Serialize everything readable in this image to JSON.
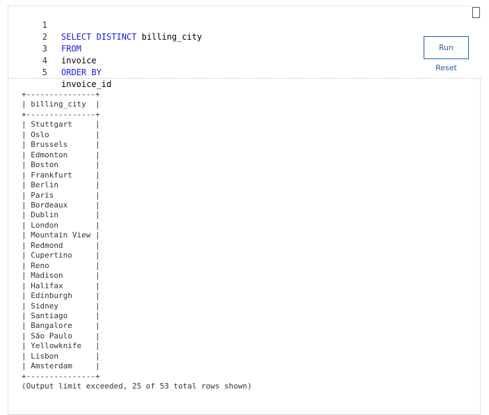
{
  "editor": {
    "lines": [
      {
        "number": "1",
        "text": "SELECT DISTINCT billing_city",
        "keyword": "SELECT DISTINCT",
        "rest": " billing_city"
      },
      {
        "number": "2",
        "text": "FROM",
        "keyword": "FROM",
        "rest": ""
      },
      {
        "number": "3",
        "text": "invoice",
        "keyword": "",
        "rest": "invoice"
      },
      {
        "number": "4",
        "text": "ORDER BY",
        "keyword": "ORDER BY",
        "rest": ""
      },
      {
        "number": "5",
        "text": "invoice_id",
        "keyword": "",
        "rest": "invoice_id"
      }
    ],
    "keyword_color": "#1b1bd6"
  },
  "actions": {
    "run_label": "Run",
    "reset_label": "Reset",
    "accent_color": "#1f5fa8"
  },
  "output": {
    "border_line": "+---------------+",
    "column_header": "billing_city",
    "rows": [
      "Stuttgart",
      "Oslo",
      "Brussels",
      "Edmonton",
      "Boston",
      "Frankfurt",
      "Berlin",
      "Paris",
      "Bordeaux",
      "Dublin",
      "London",
      "Mountain View",
      "Redmond",
      "Cupertino",
      "Reno",
      "Madison",
      "Halifax",
      "Edinburgh",
      "Sidney",
      "Santiago",
      "Bangalore",
      "São Paulo",
      "Yellowknife",
      "Lisbon",
      "Amsterdam"
    ],
    "limit_message": "(Output limit exceeded, 25 of 53 total rows shown)"
  }
}
